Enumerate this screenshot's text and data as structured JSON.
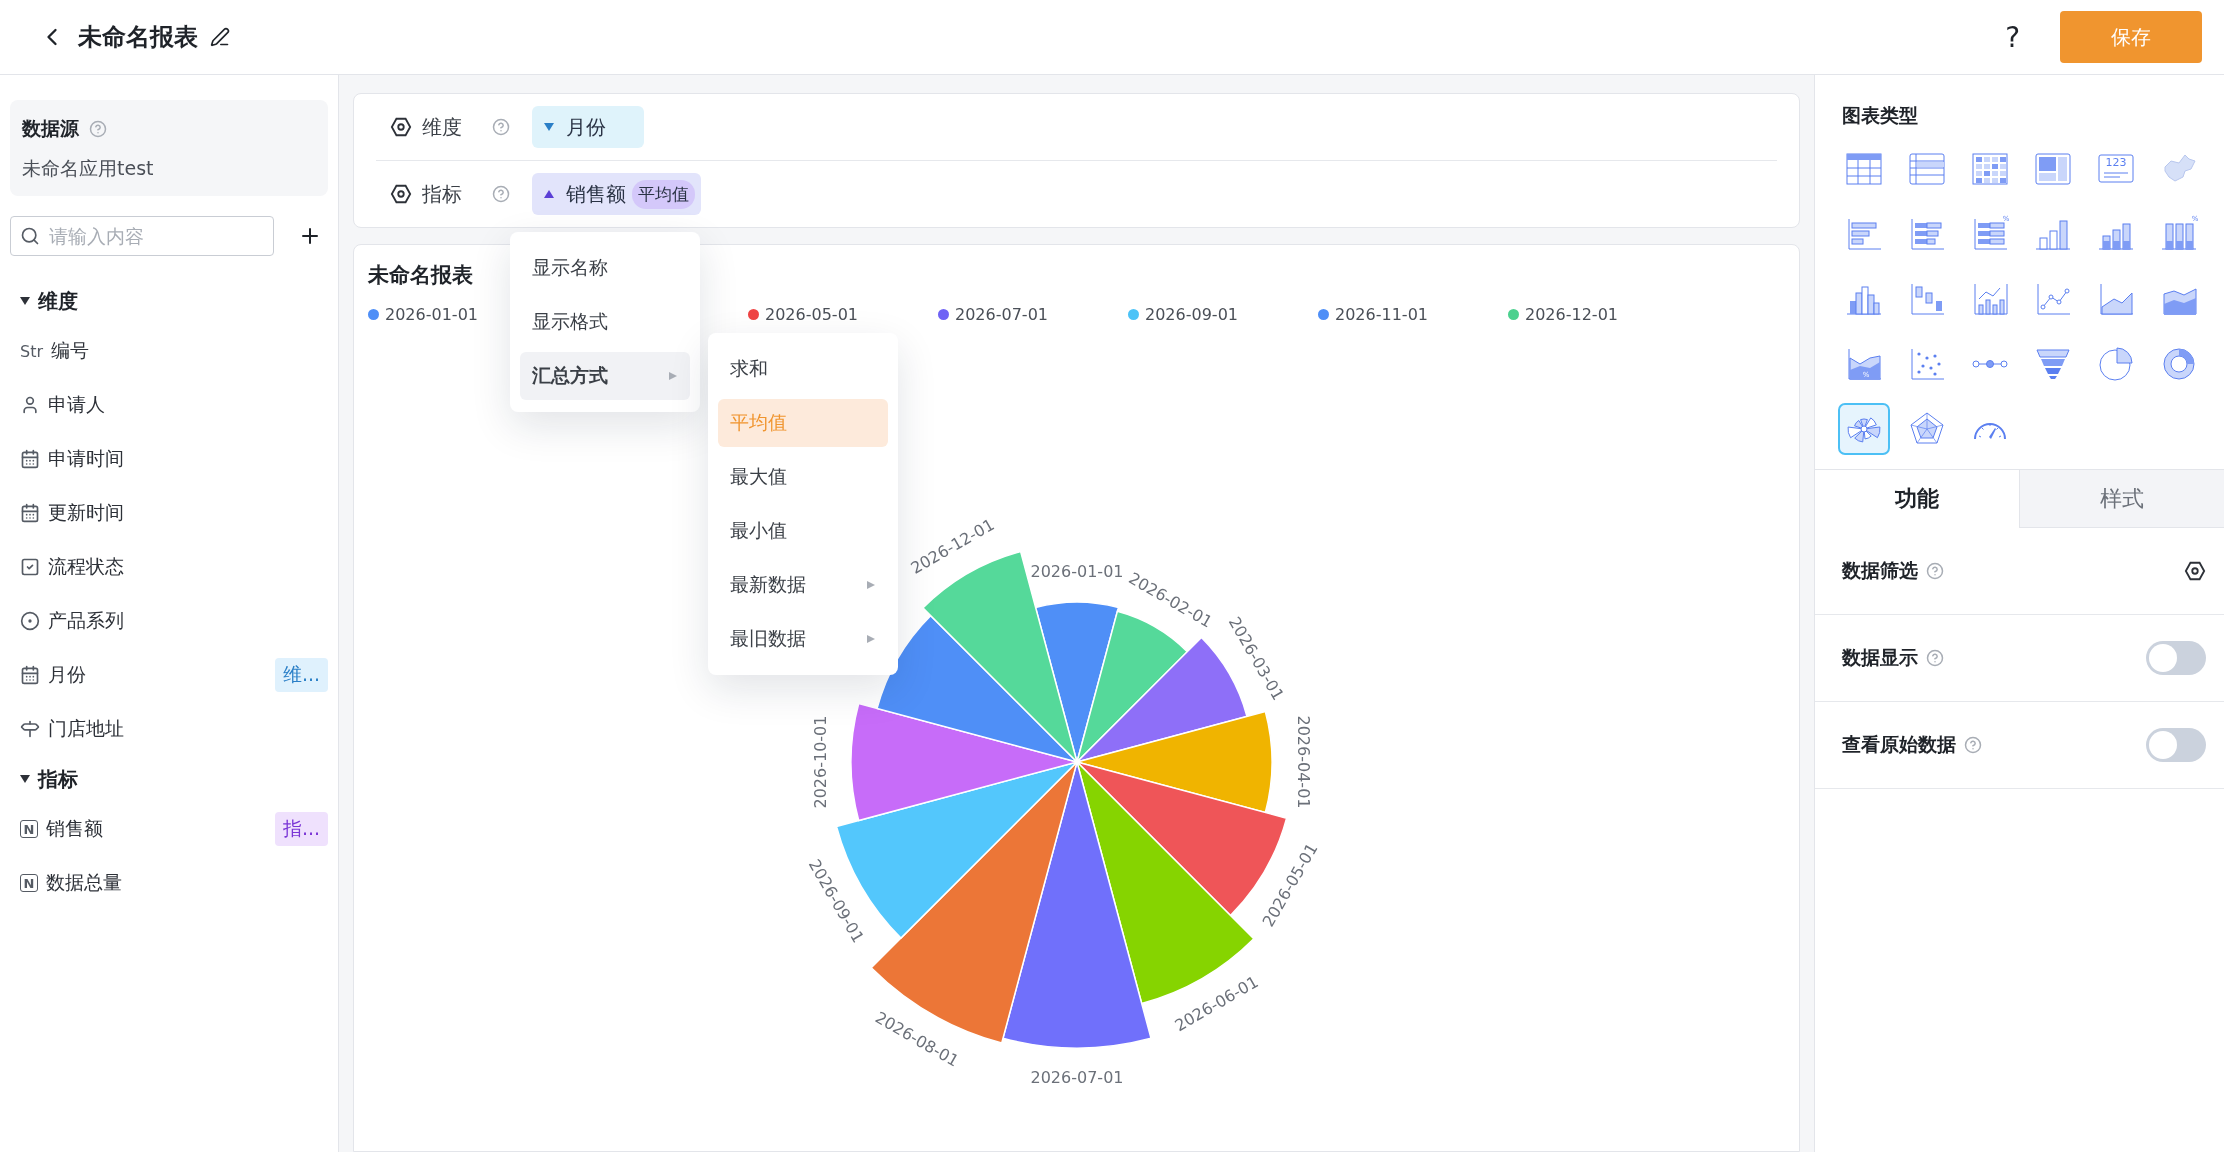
{
  "header": {
    "title": "未命名报表",
    "help": "?",
    "save": "保存"
  },
  "sidebar": {
    "datasource": {
      "label": "数据源",
      "value": "未命名应用test"
    },
    "search": {
      "placeholder": "请输入内容"
    },
    "groups": [
      {
        "title": "维度",
        "expanded": true,
        "items": [
          {
            "kind": "text",
            "type_label": "Str",
            "name": "编号"
          },
          {
            "kind": "person",
            "name": "申请人"
          },
          {
            "kind": "calendar",
            "name": "申请时间"
          },
          {
            "kind": "calendar",
            "name": "更新时间"
          },
          {
            "kind": "check",
            "name": "流程状态"
          },
          {
            "kind": "radio",
            "name": "产品系列"
          },
          {
            "kind": "calendar",
            "name": "月份",
            "badge": {
              "kind": "dimension",
              "text": "维..."
            }
          },
          {
            "kind": "location",
            "name": "门店地址"
          }
        ]
      },
      {
        "title": "指标",
        "expanded": true,
        "items": [
          {
            "kind": "number",
            "type_label": "N",
            "name": "销售额",
            "badge": {
              "kind": "measure",
              "text": "指..."
            }
          },
          {
            "kind": "number",
            "type_label": "N",
            "name": "数据总量"
          }
        ]
      }
    ]
  },
  "config": {
    "rows": [
      {
        "label": "维度",
        "chip": {
          "kind": "dimension",
          "text": "月份"
        }
      },
      {
        "label": "指标",
        "chip": {
          "kind": "measure",
          "text": "销售额",
          "tag": "平均值"
        }
      }
    ]
  },
  "field_menu": {
    "items": [
      {
        "label": "显示名称",
        "selected": false,
        "submenu": false
      },
      {
        "label": "显示格式",
        "selected": false,
        "submenu": false
      },
      {
        "label": "汇总方式",
        "selected": true,
        "submenu": true
      }
    ]
  },
  "aggregate_menu": {
    "items": [
      {
        "label": "求和",
        "selected": false,
        "submenu": false
      },
      {
        "label": "平均值",
        "selected": true,
        "submenu": false
      },
      {
        "label": "最大值",
        "selected": false,
        "submenu": false
      },
      {
        "label": "最小值",
        "selected": false,
        "submenu": false
      },
      {
        "label": "最新数据",
        "selected": false,
        "submenu": true
      },
      {
        "label": "最旧数据",
        "selected": false,
        "submenu": true
      }
    ]
  },
  "report": {
    "title": "未命名报表",
    "legend": [
      {
        "label": "2026-01-01",
        "color": "#4f8ff7"
      },
      {
        "label": "2026-05-01",
        "color": "#ef4444"
      },
      {
        "label": "2026-07-01",
        "color": "#6f63f5"
      },
      {
        "label": "2026-09-01",
        "color": "#4cc3f7"
      },
      {
        "label": "2026-11-01",
        "color": "#4f8ff7"
      },
      {
        "label": "2026-12-01",
        "color": "#4cd18f"
      }
    ],
    "sectors": [
      {
        "label": "2026-01-01",
        "color": "#4f8ff7"
      },
      {
        "label": "2026-02-01",
        "color": "#55d99a"
      },
      {
        "label": "2026-03-01",
        "color": "#8e6ff8"
      },
      {
        "label": "2026-04-01",
        "color": "#f0b400"
      },
      {
        "label": "2026-05-01",
        "color": "#ef5558"
      },
      {
        "label": "2026-06-01",
        "color": "#86d400"
      },
      {
        "label": "2026-07-01",
        "color": "#7070fb"
      },
      {
        "label": "2026-08-01",
        "color": "#ec7637"
      },
      {
        "label": "2026-09-01",
        "color": "#53c7fc"
      },
      {
        "label": "2026-10-01",
        "color": "#c76cf9"
      },
      {
        "color": "#4f8ff7"
      },
      {
        "label": "2026-12-01",
        "color": "#55d99a"
      }
    ]
  },
  "right_panel": {
    "title": "图表类型",
    "chart_types": [
      {
        "selected": false
      },
      {
        "selected": false
      },
      {
        "selected": false
      },
      {
        "selected": false
      },
      {
        "selected": false,
        "glyph": "123"
      },
      {
        "selected": false
      },
      {
        "selected": false
      },
      {
        "selected": false
      },
      {
        "selected": false,
        "glyph": "%"
      },
      {
        "selected": false
      },
      {
        "selected": false
      },
      {
        "selected": false,
        "glyph": "%"
      },
      {
        "selected": false
      },
      {
        "selected": false
      },
      {
        "selected": false
      },
      {
        "selected": false
      },
      {
        "selected": false
      },
      {
        "selected": false
      },
      {
        "selected": false,
        "glyph": "%"
      },
      {
        "selected": false
      },
      {
        "selected": false
      },
      {
        "selected": false
      },
      {
        "selected": false
      },
      {
        "selected": false
      },
      {
        "selected": true
      },
      {
        "selected": false
      },
      {
        "selected": false
      }
    ],
    "tabs": [
      {
        "label": "功能",
        "selected": true
      },
      {
        "label": "样式",
        "selected": false
      }
    ],
    "settings": [
      {
        "kind": "gear",
        "label": "数据筛选"
      },
      {
        "kind": "toggle",
        "label": "数据显示",
        "on": false
      },
      {
        "kind": "toggle",
        "label": "查看原始数据",
        "on": false
      }
    ]
  }
}
